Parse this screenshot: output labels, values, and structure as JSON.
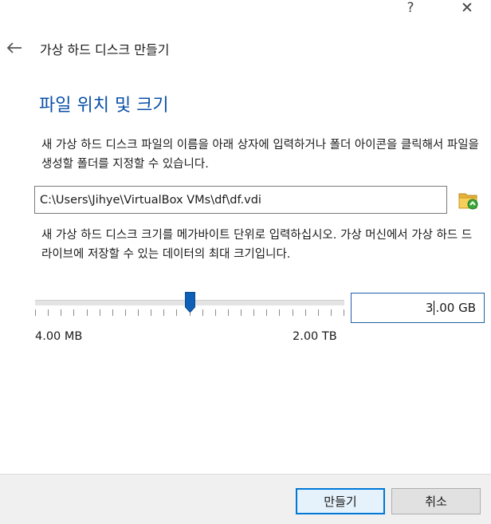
{
  "window": {
    "help_glyph": "?",
    "close_glyph": "✕"
  },
  "header": {
    "title": "가상 하드 디스크 만들기"
  },
  "section": {
    "title": "파일 위치 및 크기"
  },
  "location": {
    "description": "새 가상 하드 디스크 파일의 이름을 아래 상자에 입력하거나 폴더 아이콘을 클릭해서 파일을 생성할 폴더를 지정할 수 있습니다.",
    "path_value": "C:\\Users\\Jihye\\VirtualBox VMs\\df\\df.vdi",
    "folder_icon": "folder-open-icon"
  },
  "size": {
    "description": "새 가상 하드 디스크 크기를 메가바이트 단위로 입력하십시오. 가상 머신에서 가상 하드 드라이브에 저장할 수 있는 데이터의 최대 크기입니다.",
    "slider_fraction": 0.5,
    "tick_count": 25,
    "min_label": "4.00 MB",
    "max_label": "2.00 TB",
    "value_before_caret": "3",
    "value_after_caret": ".00 GB"
  },
  "buttons": {
    "create": "만들기",
    "cancel": "취소"
  },
  "colors": {
    "accent": "#0a4fa8",
    "thumb": "#0e5fb6",
    "focus_border": "#0078d7"
  }
}
